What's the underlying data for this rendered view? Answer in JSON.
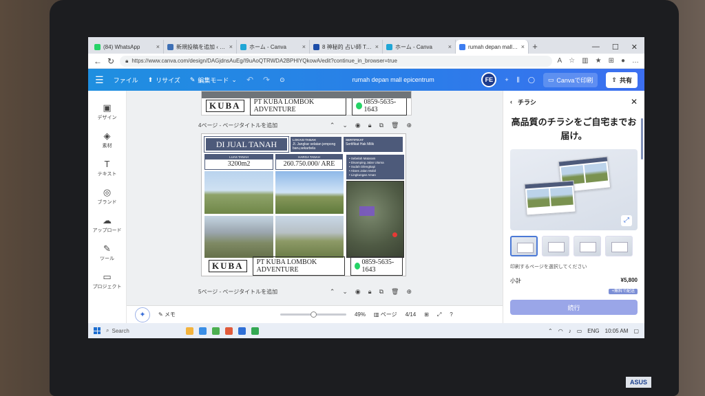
{
  "browser": {
    "tabs": [
      {
        "label": "(84) WhatsApp",
        "color": "#25d366"
      },
      {
        "label": "新規投稿を追加 ‹ 秘密の",
        "color": "#3d6fb5"
      },
      {
        "label": "ホーム - Canva",
        "color": "#1fa6d6"
      },
      {
        "label": "8 神秘的 占い師 Twitter",
        "color": "#1d4ea8"
      },
      {
        "label": "ホーム - Canva",
        "color": "#1fa6d6"
      },
      {
        "label": "rumah depan mall epic",
        "color": "#3d7df0",
        "active": true
      }
    ],
    "new_tab": "+",
    "url": "https://www.canva.com/design/DAGjdnsAuEg/I9uAoQTRWDA2BPHlYQkowA/edit?continue_in_browser=true"
  },
  "canva": {
    "file_label": "ファイル",
    "resize_label": "リサイズ",
    "edit_mode_label": "編集モード",
    "doc_title": "rumah depan mall epicentrum",
    "avatar_initials": "FE",
    "print_label": "Canvaで印刷",
    "share_label": "共有"
  },
  "sidebar": [
    {
      "label": "デザイン",
      "icon": "layout-icon",
      "glyph": "▣"
    },
    {
      "label": "素材",
      "icon": "elements-icon",
      "glyph": "◈"
    },
    {
      "label": "テキスト",
      "icon": "text-icon",
      "glyph": "T"
    },
    {
      "label": "ブランド",
      "icon": "brand-icon",
      "glyph": "◎"
    },
    {
      "label": "アップロード",
      "icon": "upload-icon",
      "glyph": "☁"
    },
    {
      "label": "ツール",
      "icon": "draw-icon",
      "glyph": "✎"
    },
    {
      "label": "プロジェクト",
      "icon": "folder-icon",
      "glyph": "▭"
    }
  ],
  "flyer": {
    "logo_text": "KUBA",
    "company": "PT KUBA LOMBOK ADVENTURE",
    "phone": "0859-5635-1643",
    "title": "DI JUAL TANAH",
    "location_label": "LOKASI TANAH",
    "location_value": "Jl. Jangkar selatan jempong baru,sekarbela",
    "cert_label": "SERTIFIKAT",
    "cert_value": "Sertifikat Hak Milik",
    "area_label": "LUAS TANAH",
    "area_value": "3200m2",
    "price_label": "HARGA TANAH",
    "price_value": "260.750.000/ ARE",
    "features": [
      "Sebelah Mataram",
      "Disamping Jalan Utama",
      "Sudah Dilengkapi",
      "Akses Jalan Mobil",
      "Lingkungan Aman"
    ]
  },
  "pages": {
    "page4_title": "4ページ - ページタイトルを追加",
    "page5_title": "5ページ - ページタイトルを追加"
  },
  "bottom_bar": {
    "notes_label": "メモ",
    "zoom": "49%",
    "pages_label": "ページ",
    "page_indicator": "4/14",
    "help": "?"
  },
  "panel": {
    "title": "チラシ",
    "headline": "高品質のチラシをご自宅までお届け。",
    "select_pages_text": "印刷するページを選択してください",
    "subtotal_label": "小計",
    "subtotal_value": "¥5,800",
    "shipping_badge": "+無料で配送",
    "next_label": "続行"
  },
  "taskbar": {
    "search_label": "Search",
    "language": "ENG",
    "time": "10:05 AM"
  }
}
